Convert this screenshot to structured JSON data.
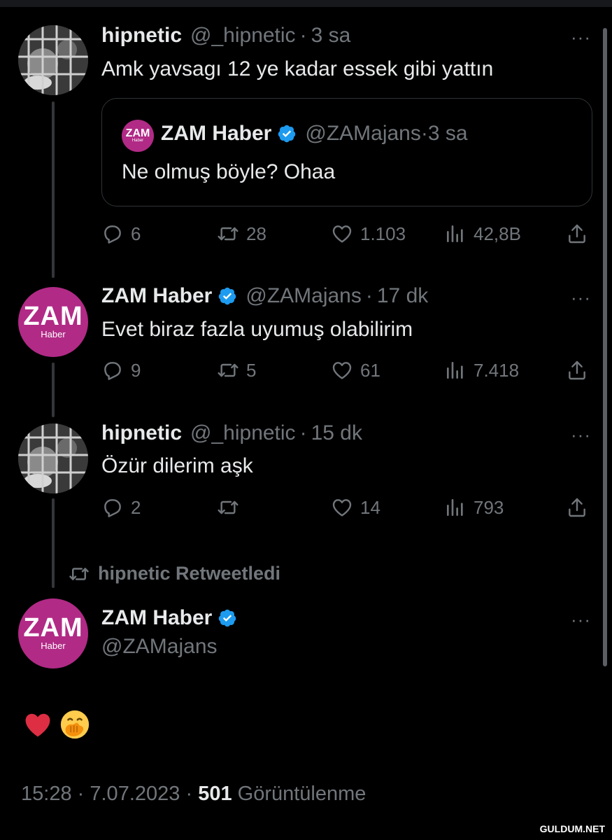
{
  "tweets": [
    {
      "name": "hipnetic",
      "handle": "@_hipnetic",
      "time": "3 sa",
      "text": "Amk yavsagı 12 ye kadar essek gibi yattın",
      "quote": {
        "name": "ZAM Haber",
        "handle": "@ZAMajans",
        "time": "3 sa",
        "text": "Ne olmuş böyle? Ohaa"
      },
      "replies": "6",
      "retweets": "28",
      "likes": "1.103",
      "views": "42,8B"
    },
    {
      "name": "ZAM Haber",
      "handle": "@ZAMajans",
      "time": "17 dk",
      "text": "Evet biraz fazla uyumuş olabilirim",
      "replies": "9",
      "retweets": "5",
      "likes": "61",
      "views": "7.418"
    },
    {
      "name": "hipnetic",
      "handle": "@_hipnetic",
      "time": "15 dk",
      "text": "Özür dilerim aşk",
      "replies": "2",
      "retweets": "",
      "likes": "14",
      "views": "793"
    }
  ],
  "retweet_context": "hipnetic Retweetledi",
  "main_tweet": {
    "name": "ZAM Haber",
    "handle": "@ZAMajans",
    "content_emojis": [
      "red-heart",
      "face-with-hand-over-mouth"
    ],
    "time": "15:28",
    "date": "7.07.2023",
    "views": "501",
    "views_label": "Görüntülenme"
  },
  "separator": "·",
  "more_label": "···",
  "avatar_text": {
    "big": "ZAM",
    "small": "Haber"
  },
  "watermark": "GULDUM.NET",
  "colors": {
    "background": "#000000",
    "text": "#e7e9ea",
    "muted": "#71767b",
    "verified": "#1d9bf0",
    "zam_brand": "#b12a86"
  }
}
